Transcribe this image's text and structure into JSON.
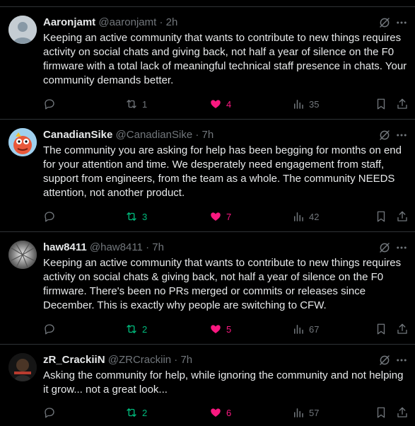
{
  "tweets": [
    {
      "name": "Aaronjamt",
      "handle": "@aaronjamt",
      "time": "2h",
      "text": "Keeping an active community that wants to contribute to new things requires activity on social chats and giving back, not half a year of silence on the F0 firmware with a total lack of meaningful technical staff presence in chats. Your community demands better.",
      "replies": "",
      "reposts": "1",
      "likes": "4",
      "views": "35",
      "reposted": false,
      "liked": true,
      "avatar": "default-avatar"
    },
    {
      "name": "CanadianSike",
      "handle": "@CanadianSike",
      "time": "7h",
      "text": "The community you are asking for help has been begging for months on end for your attention and time. We desperately need engagement from staff, support from engineers, from the team as a whole. The community NEEDS attention, not another product.",
      "replies": "",
      "reposts": "3",
      "likes": "7",
      "views": "42",
      "reposted": true,
      "liked": true,
      "avatar": "cartoon-avatar"
    },
    {
      "name": "haw8411",
      "handle": "@haw8411",
      "time": "7h",
      "text": "Keeping an active community that wants to contribute to new things requires activity on social chats & giving back, not half a year of silence on the F0 firmware. There's been no PRs merged or commits or releases since December. This is exactly why people are switching to CFW.",
      "replies": "",
      "reposts": "2",
      "likes": "5",
      "views": "67",
      "reposted": true,
      "liked": true,
      "avatar": "photo-avatar"
    },
    {
      "name": "zR_CrackiiN",
      "handle": "@ZRCrackiin",
      "time": "7h",
      "text": "Asking the community for help, while ignoring the community and not helping it grow... not a great look...",
      "replies": "",
      "reposts": "2",
      "likes": "6",
      "views": "57",
      "reposted": true,
      "liked": true,
      "avatar": "dark-avatar"
    }
  ],
  "sep": "·",
  "colors": {
    "repost": "#00ba7c",
    "like": "#f91880",
    "muted": "#71767b",
    "border": "#2f3336"
  }
}
